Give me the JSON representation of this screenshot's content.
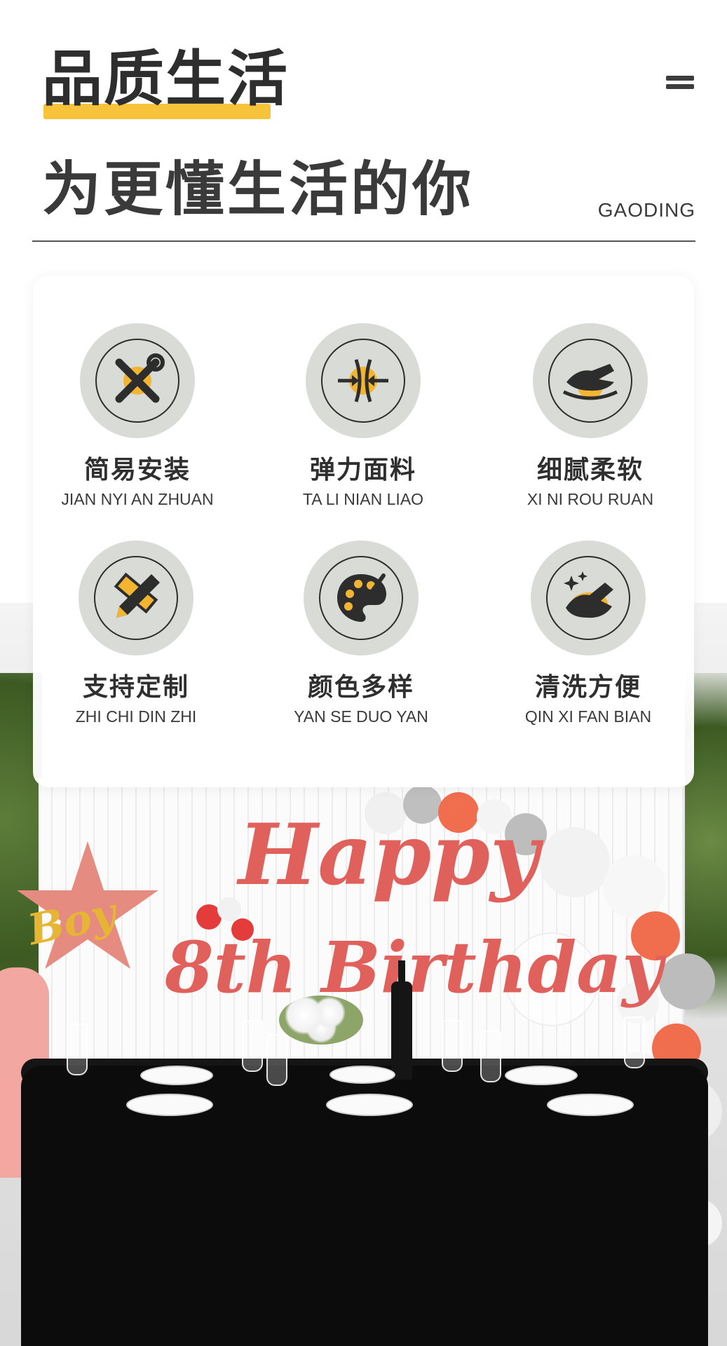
{
  "header": {
    "title": "品质生活",
    "subtitle": "为更懂生活的你",
    "brand": "GAODING",
    "menu_icon": "menu-icon",
    "accent_color": "#f6c33a"
  },
  "features": [
    {
      "label": "简易安装",
      "pinyin": "JIAN NYI AN ZHUAN",
      "icon": "wrench-screwdriver-icon"
    },
    {
      "label": "弹力面料",
      "pinyin": "TA LI NIAN LIAO",
      "icon": "elastic-fabric-icon"
    },
    {
      "label": "细腻柔软",
      "pinyin": "XI NI ROU RUAN",
      "icon": "soft-hand-icon"
    },
    {
      "label": "支持定制",
      "pinyin": "ZHI CHI DIN ZHI",
      "icon": "pencil-ruler-icon"
    },
    {
      "label": "颜色多样",
      "pinyin": "YAN SE DUO YAN",
      "icon": "color-palette-icon"
    },
    {
      "label": "清洗方便",
      "pinyin": "QIN XI FAN BIAN",
      "icon": "cleaning-hand-icon"
    }
  ],
  "photo": {
    "banner_line1": "Happy",
    "banner_line2": "8th Birthday",
    "balloon_text": "Boy"
  }
}
